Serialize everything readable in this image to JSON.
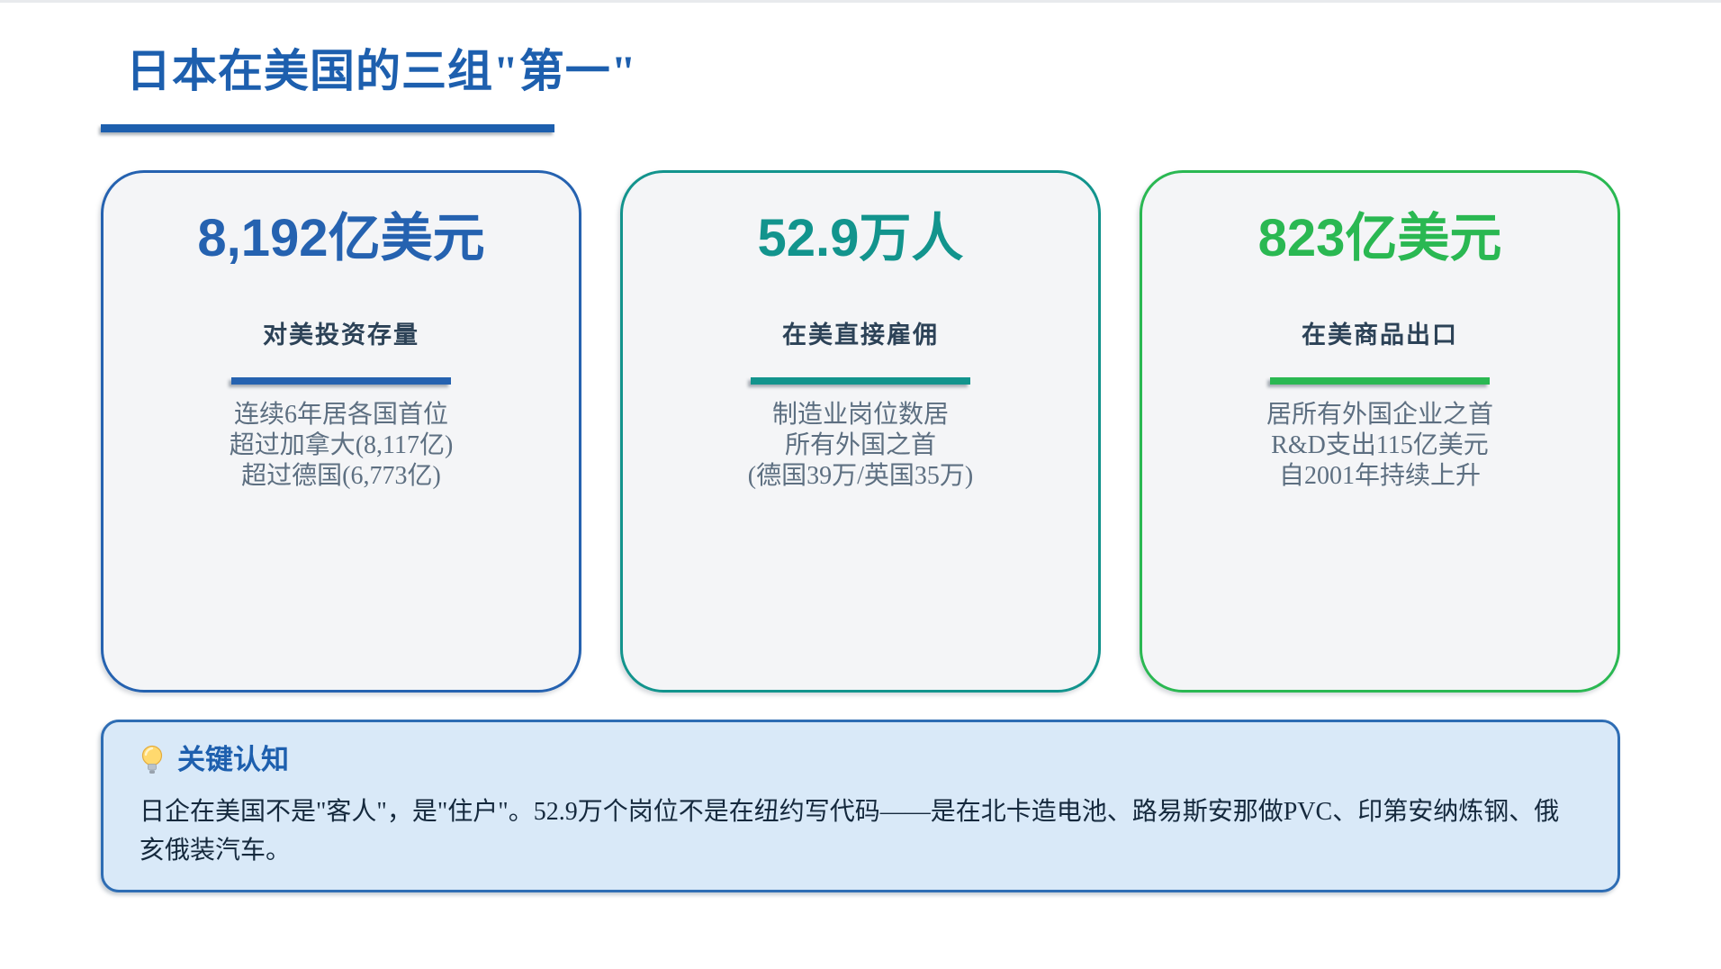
{
  "title": "日本在美国的三组\"第一\"",
  "title_color": "#1d5fae",
  "cards": [
    {
      "value": "8,192亿美元",
      "label": "对美投资存量",
      "accent": "#2562b0",
      "lines": [
        "连续6年居各国首位",
        "超过加拿大(8,117亿)",
        "超过德国(6,773亿)"
      ]
    },
    {
      "value": "52.9万人",
      "label": "在美直接雇佣",
      "accent": "#12948d",
      "lines": [
        "制造业岗位数居",
        "所有外国之首",
        "(德国39万/英国35万)"
      ]
    },
    {
      "value": "823亿美元",
      "label": "在美商品出口",
      "accent": "#2ab852",
      "lines": [
        "居所有外国企业之首",
        "R&D支出115亿美元",
        "自2001年持续上升"
      ]
    }
  ],
  "callout": {
    "icon": "lightbulb-icon",
    "heading": "关键认知",
    "body": "日企在美国不是\"客人\"，是\"住户\"。52.9万个岗位不是在纽约写代码——是在北卡造电池、路易斯安那做PVC、印第安纳炼钢、俄亥俄装汽车。",
    "background": "#d9e9f8",
    "border_color": "#2e6db4",
    "heading_color": "#1d5fae"
  }
}
